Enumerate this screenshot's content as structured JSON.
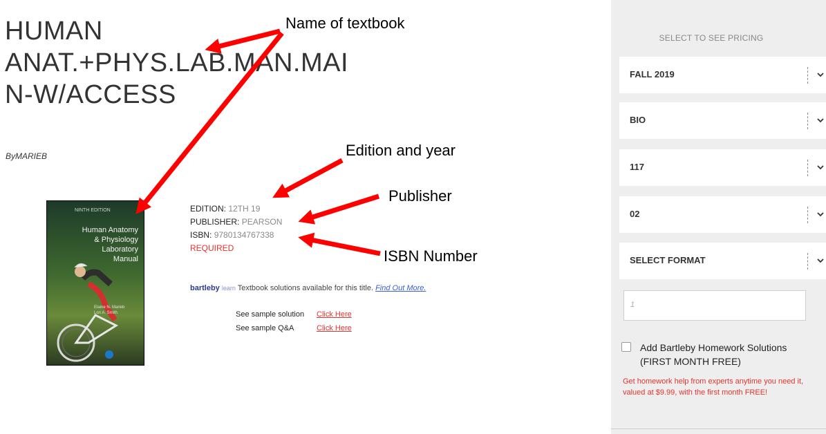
{
  "book": {
    "title_lines": [
      "HUMAN",
      "ANAT.+PHYS.LAB.MAN.MAI",
      "N-W/ACCESS"
    ],
    "byline": "ByMARIEB",
    "edition_label": "EDITION:",
    "edition_value": "12TH 19",
    "publisher_label": "PUBLISHER:",
    "publisher_value": "PEARSON",
    "isbn_label": "ISBN:",
    "isbn_value": "9780134767338",
    "required": "REQUIRED"
  },
  "cover": {
    "title_lines": [
      "Human Anatomy",
      "& Physiology",
      "Laboratory",
      "Manual"
    ],
    "small_text": "NINTH EDITION",
    "authors": [
      "Elaine N. Marieb",
      "Lori A. Smith"
    ]
  },
  "bartleby": {
    "brand": "bartleby",
    "brand_suffix": "learn",
    "text": "Textbook solutions available for this title.",
    "link": "Find Out More."
  },
  "samples": [
    {
      "label": "See sample solution",
      "link": "Click Here"
    },
    {
      "label": "See sample Q&A",
      "link": "Click Here"
    }
  ],
  "annotations": {
    "name": "Name of textbook",
    "edition": "Edition and year",
    "publisher": "Publisher",
    "isbn": "ISBN Number"
  },
  "panel": {
    "heading": "SELECT TO SEE PRICING",
    "selects": [
      "FALL 2019",
      "BIO",
      "117",
      "02",
      "SELECT FORMAT"
    ],
    "quantity_placeholder": "1",
    "addon_label": "Add Bartleby Homework Solutions (FIRST MONTH FREE)",
    "addon_desc": "Get homework help from experts anytime you need it, valued at $9.99, with the first month FREE!"
  },
  "colors": {
    "accent_red": "#e5322c",
    "arrow_red": "#ff0000",
    "panel_bg": "#eeeeee"
  }
}
